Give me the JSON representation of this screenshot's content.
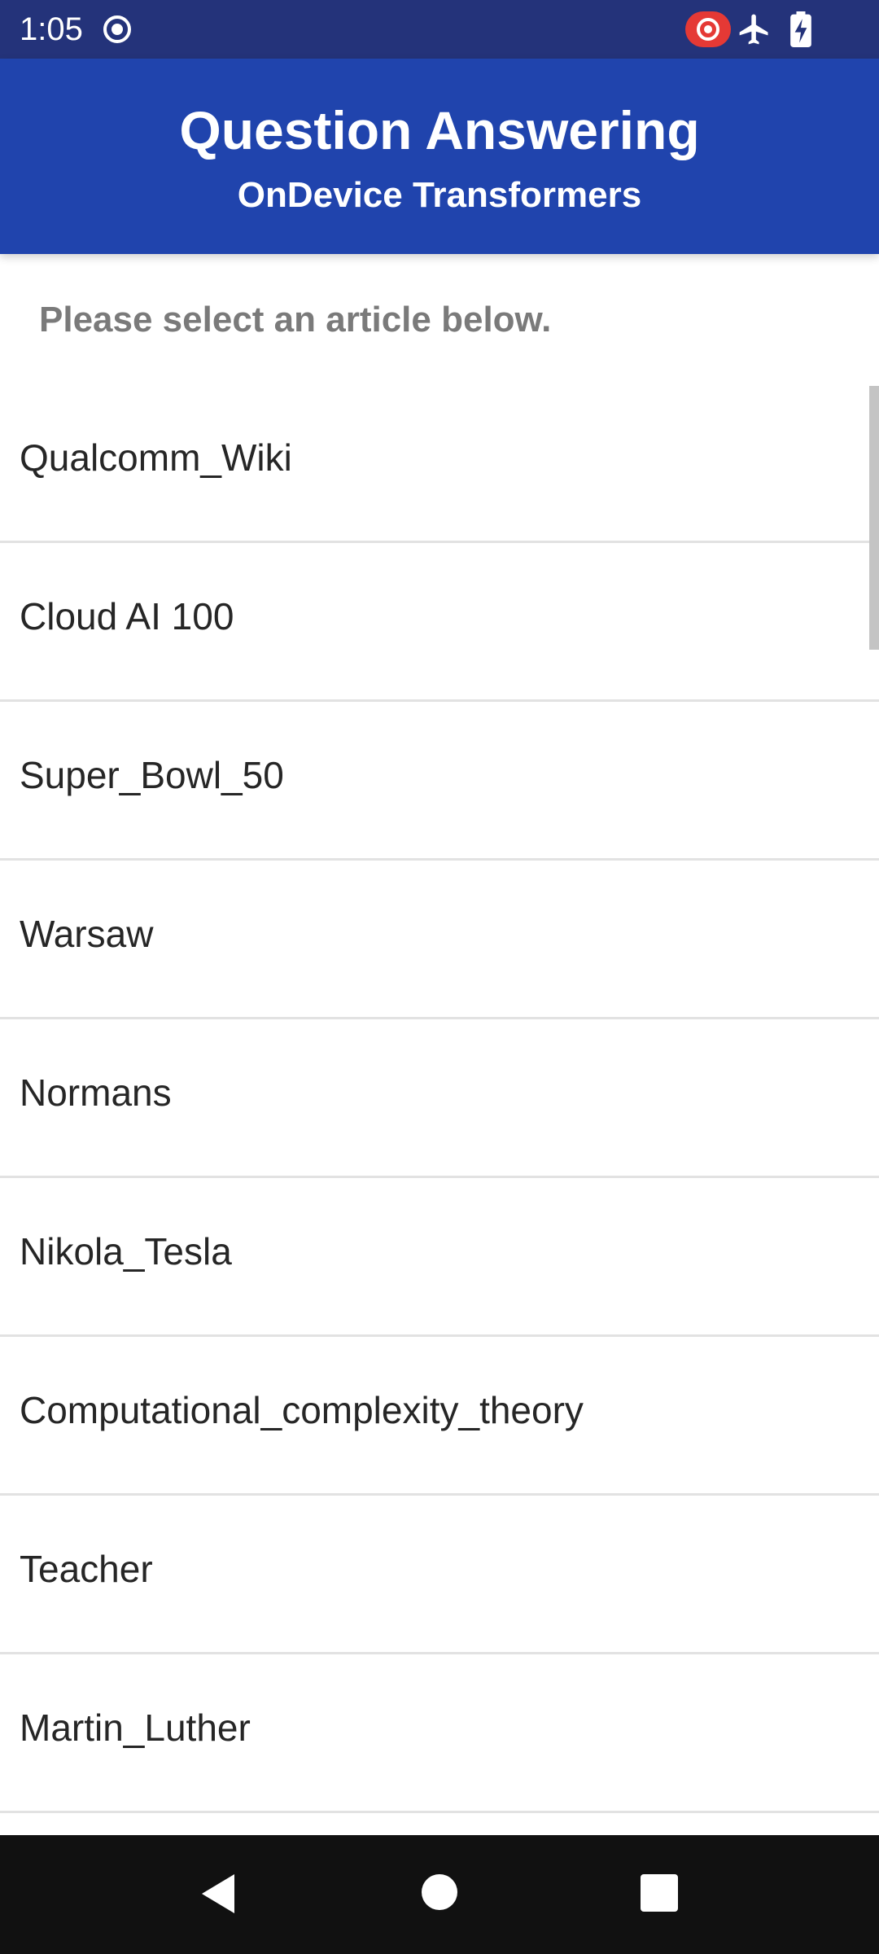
{
  "status_bar": {
    "time": "1:05",
    "icons": [
      "screen-record-icon",
      "recording-indicator-icon",
      "airplane-mode-icon",
      "battery-charging-icon"
    ],
    "background": "#24337a"
  },
  "app_bar": {
    "title": "Question Answering",
    "subtitle": "OnDevice Transformers",
    "background": "#2044ad"
  },
  "instruction": "Please select an article below.",
  "articles": [
    {
      "label": "Qualcomm_Wiki"
    },
    {
      "label": "Cloud AI 100"
    },
    {
      "label": "Super_Bowl_50"
    },
    {
      "label": "Warsaw"
    },
    {
      "label": "Normans"
    },
    {
      "label": "Nikola_Tesla"
    },
    {
      "label": "Computational_complexity_theory"
    },
    {
      "label": "Teacher"
    },
    {
      "label": "Martin_Luther"
    },
    {
      "label": ""
    }
  ],
  "nav_bar": {
    "icons": [
      "back-icon",
      "home-icon",
      "recents-icon"
    ]
  }
}
